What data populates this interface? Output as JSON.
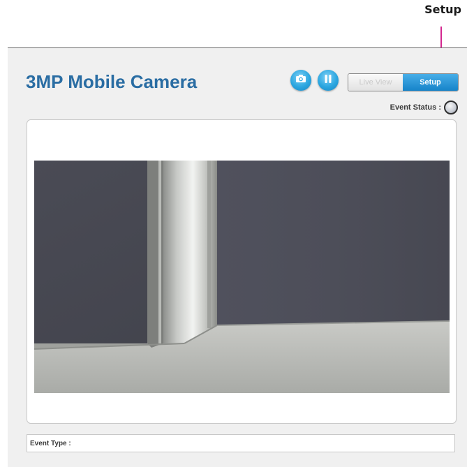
{
  "callout": {
    "label": "Setup"
  },
  "header": {
    "title": "3MP Mobile Camera"
  },
  "toolbar": {
    "snapshot_icon": "camera-icon",
    "pause_icon": "pause-icon",
    "live_view_label": "Live View",
    "setup_label": "Setup",
    "selected_tab": "Setup"
  },
  "event_status": {
    "label": "Event Status :"
  },
  "video": {
    "content": "camera-live-feed"
  },
  "event_type": {
    "label": "Event Type :"
  },
  "colors": {
    "accent": "#1a8fd6",
    "title": "#2a6da3",
    "callout_line": "#d4268f"
  }
}
